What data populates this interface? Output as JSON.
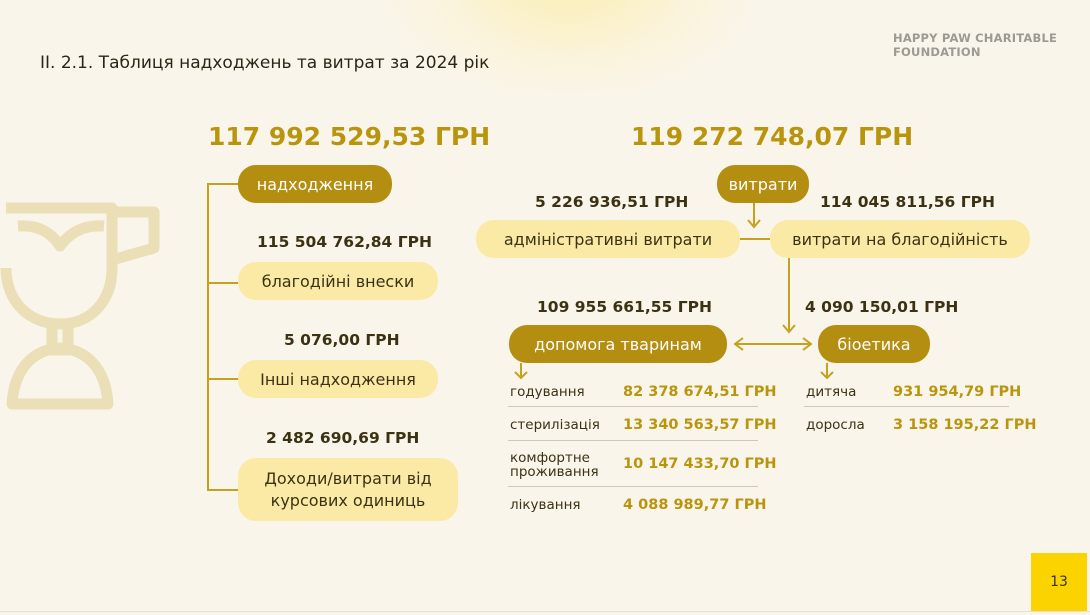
{
  "header": {
    "title": "II. 2.1. Таблиця надходжень та витрат за 2024 рік",
    "brand_line1": "HAPPY PAW CHARITABLE",
    "brand_line2": "FOUNDATION"
  },
  "income": {
    "total": "117 992 529,53 ГРН",
    "label": "надходження",
    "items": [
      {
        "amount": "115 504 762,84 ГРН",
        "label": "благодійні внески"
      },
      {
        "amount": "5 076,00 ГРН",
        "label": "Інші надходження"
      },
      {
        "amount": "2 482 690,69 ГРН",
        "label_line1": "Доходи/витрати від",
        "label_line2": "курсових одиниць"
      }
    ]
  },
  "expenses": {
    "total": "119 272 748,07 ГРН",
    "label": "витрати",
    "admin": {
      "amount": "5 226 936,51 ГРН",
      "label": "адміністративні витрати"
    },
    "charity": {
      "amount": "114 045 811,56 ГРН",
      "label": "витрати на благодійність"
    },
    "animals": {
      "amount": "109 955 661,55 ГРН",
      "label": "допомога тваринам",
      "rows": [
        {
          "label": "годування",
          "value": "82 378 674,51 ГРН"
        },
        {
          "label": "стерилізація",
          "value": "13 340 563,57 ГРН"
        },
        {
          "label_line1": "комфортне",
          "label_line2": "проживання",
          "value": "10 147 433,70 ГРН"
        },
        {
          "label": "лікування",
          "value": "4 088 989,77 ГРН"
        }
      ]
    },
    "bioethics": {
      "amount": "4 090 150,01 ГРН",
      "label": "біоетика",
      "rows": [
        {
          "label": "дитяча",
          "value": "931 954,79 ГРН"
        },
        {
          "label": "доросла",
          "value": "3 158 195,22 ГРН"
        }
      ]
    }
  },
  "page_number": "13",
  "colors": {
    "accent_dark": "#b38e10",
    "accent_light": "#fbeaa6",
    "amount_gold": "#b9950e",
    "page_badge": "#fbd400",
    "background": "#faf5ea"
  },
  "icons": {
    "background": "trophy-cup-icon"
  }
}
